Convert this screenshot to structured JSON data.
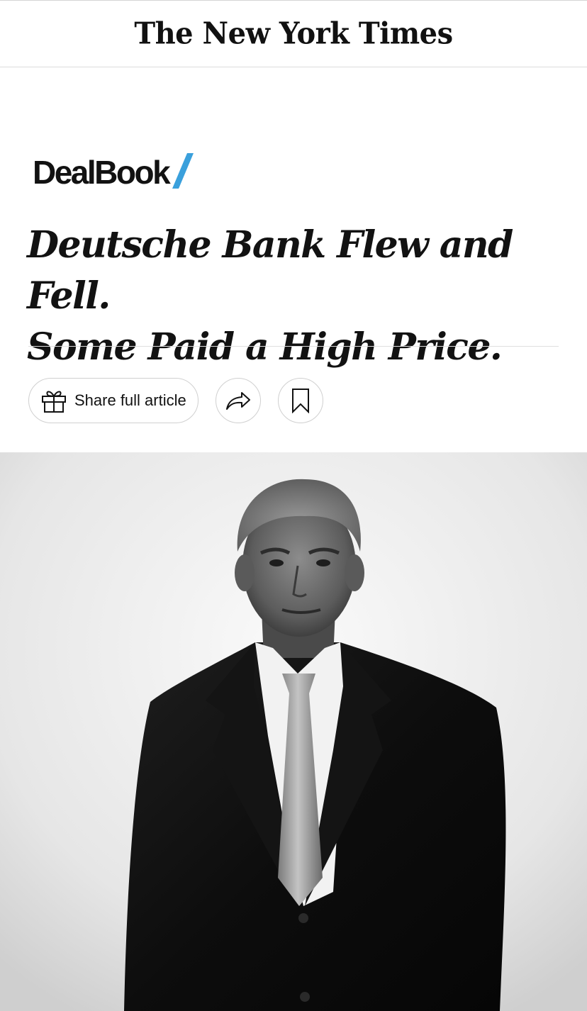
{
  "masthead": {
    "logo_text": "The New York Times"
  },
  "section": {
    "kicker": "DealBook",
    "kicker_accent_color": "#3aa0dc"
  },
  "article": {
    "headline_line1": "Deutsche Bank Flew and Fell.",
    "headline_line2": "Some Paid a High Price."
  },
  "actions": {
    "share_full_article_label": "Share full article",
    "share_icon": "share-arrow-icon",
    "save_icon": "bookmark-icon",
    "gift_icon": "gift-icon"
  },
  "photo": {
    "style": "black-and-white portrait"
  }
}
